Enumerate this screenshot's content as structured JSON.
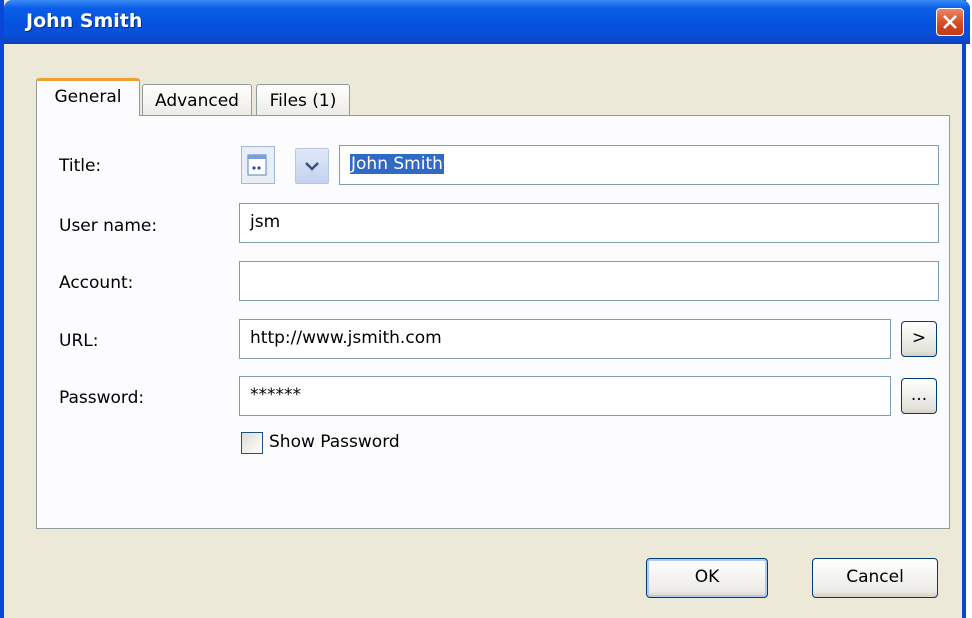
{
  "window": {
    "title": "John Smith"
  },
  "tabs": [
    {
      "label": "General",
      "active": true
    },
    {
      "label": "Advanced",
      "active": false
    },
    {
      "label": "Files (1)",
      "active": false
    }
  ],
  "form": {
    "title_label": "Title:",
    "title_value": "John Smith",
    "username_label": "User name:",
    "username_value": "jsm",
    "account_label": "Account:",
    "account_value": "",
    "url_label": "URL:",
    "url_value": "http://www.jsmith.com",
    "url_button": ">",
    "password_label": "Password:",
    "password_value": "******",
    "password_button": "...",
    "show_password_label": "Show Password",
    "show_password_checked": false
  },
  "buttons": {
    "ok": "OK",
    "cancel": "Cancel"
  },
  "icons": {
    "entry_icon": "key-card-icon",
    "dropdown": "chevron-down-icon",
    "close": "close-icon"
  },
  "colors": {
    "titlebar": "#0454e0",
    "selection": "#316ac5",
    "close": "#d74a25",
    "tab_accent": "#f0a030"
  }
}
